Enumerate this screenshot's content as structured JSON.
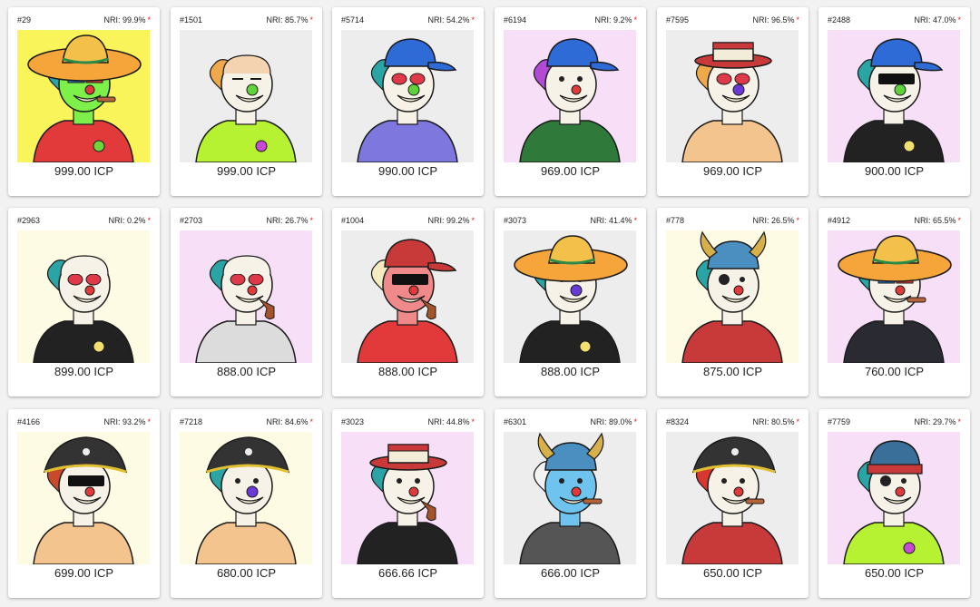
{
  "listings": [
    {
      "id": "#29",
      "nri": "NRI: 99.9%",
      "price": "999.00 ICP",
      "bg": "#f9f45a",
      "skin": "#7df04a",
      "hat": "sombrero",
      "hatColor": "#f5a53a",
      "shirt": "#e23a3a",
      "hair": "#2aa4a4",
      "nose": "cigar",
      "eyes": "glasses3d",
      "badge": "skull-green"
    },
    {
      "id": "#1501",
      "nri": "NRI: 85.7%",
      "price": "999.00 ICP",
      "bg": "#ededed",
      "skin": "#f6f2e7",
      "hat": "bald",
      "hatColor": "#f3d3b0",
      "shirt": "#b6f231",
      "hair": "#f0a94a",
      "nose": "green",
      "eyes": "closed",
      "badge": "skull-purple"
    },
    {
      "id": "#5714",
      "nri": "NRI: 54.2%",
      "price": "990.00 ICP",
      "bg": "#ededed",
      "skin": "#f6f2e7",
      "hat": "cap",
      "hatColor": "#2e6bd6",
      "shirt": "#7d77de",
      "hair": "#2aa4a4",
      "nose": "green",
      "eyes": "heart",
      "badge": ""
    },
    {
      "id": "#6194",
      "nri": "NRI: 9.2%",
      "price": "969.00 ICP",
      "bg": "#f6dff7",
      "skin": "#f6f2e7",
      "hat": "cap",
      "hatColor": "#2e6bd6",
      "shirt": "#2f7a3a",
      "hair": "#b24ad6",
      "nose": "none",
      "eyes": "none",
      "badge": ""
    },
    {
      "id": "#7595",
      "nri": "NRI: 96.5%",
      "price": "969.00 ICP",
      "bg": "#ededed",
      "skin": "#f6f2e7",
      "hat": "boater",
      "hatColor": "#c83a3a",
      "shirt": "#f3c48e",
      "hair": "#f0a94a",
      "nose": "purple",
      "eyes": "heart",
      "badge": ""
    },
    {
      "id": "#2488",
      "nri": "NRI: 47.0%",
      "price": "900.00 ICP",
      "bg": "#f6dff7",
      "skin": "#f6f2e7",
      "hat": "cap",
      "hatColor": "#2e6bd6",
      "shirt": "#222222",
      "hair": "#2aa4a4",
      "nose": "green",
      "eyes": "shades",
      "badge": "skull-yellow"
    },
    {
      "id": "#2963",
      "nri": "NRI: 0.2%",
      "price": "899.00 ICP",
      "bg": "#fdfbe3",
      "skin": "#f6f2e7",
      "hat": "bald",
      "hatColor": "#f6f2e7",
      "shirt": "#222222",
      "hair": "#2aa4a4",
      "nose": "none",
      "eyes": "heart",
      "badge": "skull-yellow"
    },
    {
      "id": "#2703",
      "nri": "NRI: 26.7%",
      "price": "888.00 ICP",
      "bg": "#f6dff7",
      "skin": "#f6f2e7",
      "hat": "bald",
      "hatColor": "#f6f2e7",
      "shirt": "#dcdcdc",
      "hair": "#2aa4a4",
      "nose": "pipe",
      "eyes": "heart",
      "badge": ""
    },
    {
      "id": "#1004",
      "nri": "NRI: 99.2%",
      "price": "888.00 ICP",
      "bg": "#ededed",
      "skin": "#f08a8a",
      "hat": "cap",
      "hatColor": "#c83a3a",
      "shirt": "#e23a3a",
      "hair": "#f3ecc0",
      "nose": "pipe",
      "eyes": "shades",
      "badge": ""
    },
    {
      "id": "#3073",
      "nri": "NRI: 41.4%",
      "price": "888.00 ICP",
      "bg": "#ededed",
      "skin": "#f6f2e7",
      "hat": "sombrero",
      "hatColor": "#f5a53a",
      "shirt": "#222222",
      "hair": "#2aa4a4",
      "nose": "purple",
      "eyes": "none",
      "badge": "skull-yellow"
    },
    {
      "id": "#778",
      "nri": "NRI: 26.5%",
      "price": "875.00 ICP",
      "bg": "#fdfbe3",
      "skin": "#f6f2e7",
      "hat": "viking",
      "hatColor": "#4a8fc0",
      "shirt": "#c83a3a",
      "hair": "#2aa4a4",
      "nose": "none",
      "eyes": "patch",
      "badge": ""
    },
    {
      "id": "#4912",
      "nri": "NRI: 65.5%",
      "price": "760.00 ICP",
      "bg": "#f6dff7",
      "skin": "#f6f2e7",
      "hat": "sombrero",
      "hatColor": "#f5a53a",
      "shirt": "#2a2a33",
      "hair": "#2aa4a4",
      "nose": "cigar",
      "eyes": "glasses3d",
      "badge": ""
    },
    {
      "id": "#4166",
      "nri": "NRI: 93.2%",
      "price": "699.00 ICP",
      "bg": "#fdfbe3",
      "skin": "#f6f2e7",
      "hat": "pirate",
      "hatColor": "#333333",
      "shirt": "#f3c48e",
      "hair": "#c84a2a",
      "nose": "none",
      "eyes": "shades",
      "badge": ""
    },
    {
      "id": "#7218",
      "nri": "NRI: 84.6%",
      "price": "680.00 ICP",
      "bg": "#fdfbe3",
      "skin": "#f6f2e7",
      "hat": "pirate",
      "hatColor": "#333333",
      "shirt": "#f3c48e",
      "hair": "#2aa4a4",
      "nose": "purple",
      "eyes": "none",
      "badge": ""
    },
    {
      "id": "#3023",
      "nri": "NRI: 44.8%",
      "price": "666.66 ICP",
      "bg": "#f6dff7",
      "skin": "#f6f2e7",
      "hat": "boater",
      "hatColor": "#c83a3a",
      "shirt": "#222222",
      "hair": "#2aa4a4",
      "nose": "pipe",
      "eyes": "none",
      "badge": ""
    },
    {
      "id": "#6301",
      "nri": "NRI: 89.0%",
      "price": "666.00 ICP",
      "bg": "#ededed",
      "skin": "#6fc4ef",
      "hat": "viking",
      "hatColor": "#4a8fc0",
      "shirt": "#555555",
      "hair": "#f3f3f3",
      "nose": "cigar",
      "eyes": "none",
      "badge": ""
    },
    {
      "id": "#8324",
      "nri": "NRI: 80.5%",
      "price": "650.00 ICP",
      "bg": "#ededed",
      "skin": "#f6f2e7",
      "hat": "pirate",
      "hatColor": "#333333",
      "shirt": "#c83a3a",
      "hair": "#d8362e",
      "nose": "cigar",
      "eyes": "none",
      "badge": ""
    },
    {
      "id": "#7759",
      "nri": "NRI: 29.7%",
      "price": "650.00 ICP",
      "bg": "#f6dff7",
      "skin": "#f6f2e7",
      "hat": "beanie",
      "hatColor": "#3a6f9a",
      "shirt": "#b6f231",
      "hair": "#2aa4a4",
      "nose": "none",
      "eyes": "patch",
      "badge": "skull-purple"
    }
  ]
}
